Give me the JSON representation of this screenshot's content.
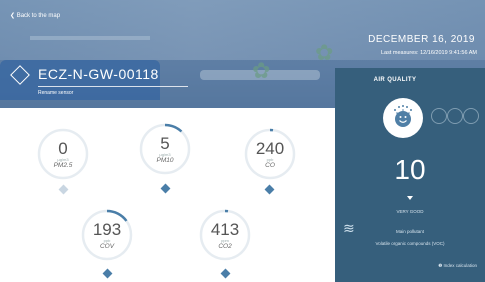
{
  "header": {
    "back_label": "❮ Back to the map",
    "date": "DECEMBER 16, 2019",
    "last_measures": "Last measures: 12/16/2019 9:41:56 AM",
    "device_name": "ECZ-N-GW-00118",
    "rename_label": "Rename sensor"
  },
  "gauges": [
    {
      "value": "0",
      "unit": "µg/m3",
      "label": "PM2.5",
      "fill": 0.0,
      "diamond_color": "#c9d6e2"
    },
    {
      "value": "5",
      "unit": "µg/m3",
      "label": "PM10",
      "fill": 0.12,
      "diamond_color": "#4a7ea8"
    },
    {
      "value": "240",
      "unit": "ppb",
      "label": "CO",
      "fill": 0.02,
      "diamond_color": "#4a7ea8"
    },
    {
      "value": "193",
      "unit": "ppb",
      "label": "COV",
      "fill": 0.15,
      "diamond_color": "#4a7ea8"
    },
    {
      "value": "413",
      "unit": "ppm",
      "label": "CO2",
      "fill": 0.02,
      "diamond_color": "#4a7ea8"
    }
  ],
  "air_quality": {
    "title": "AIR QUALITY",
    "value": "10",
    "status": "VERY GOOD",
    "pollutant_label": "Main pollutant",
    "pollutant_name": "Volatile organic compounds (VOC)",
    "index_link": "❶ Index calculation",
    "panel_color": "#365f7c",
    "face_color": "#4f7fa6"
  },
  "icons": {
    "back": "chevron-left-icon",
    "logo": "diamond-logo-icon",
    "face": "smiley-face-icon",
    "wave": "wind-waves-icon",
    "info": "info-icon"
  }
}
